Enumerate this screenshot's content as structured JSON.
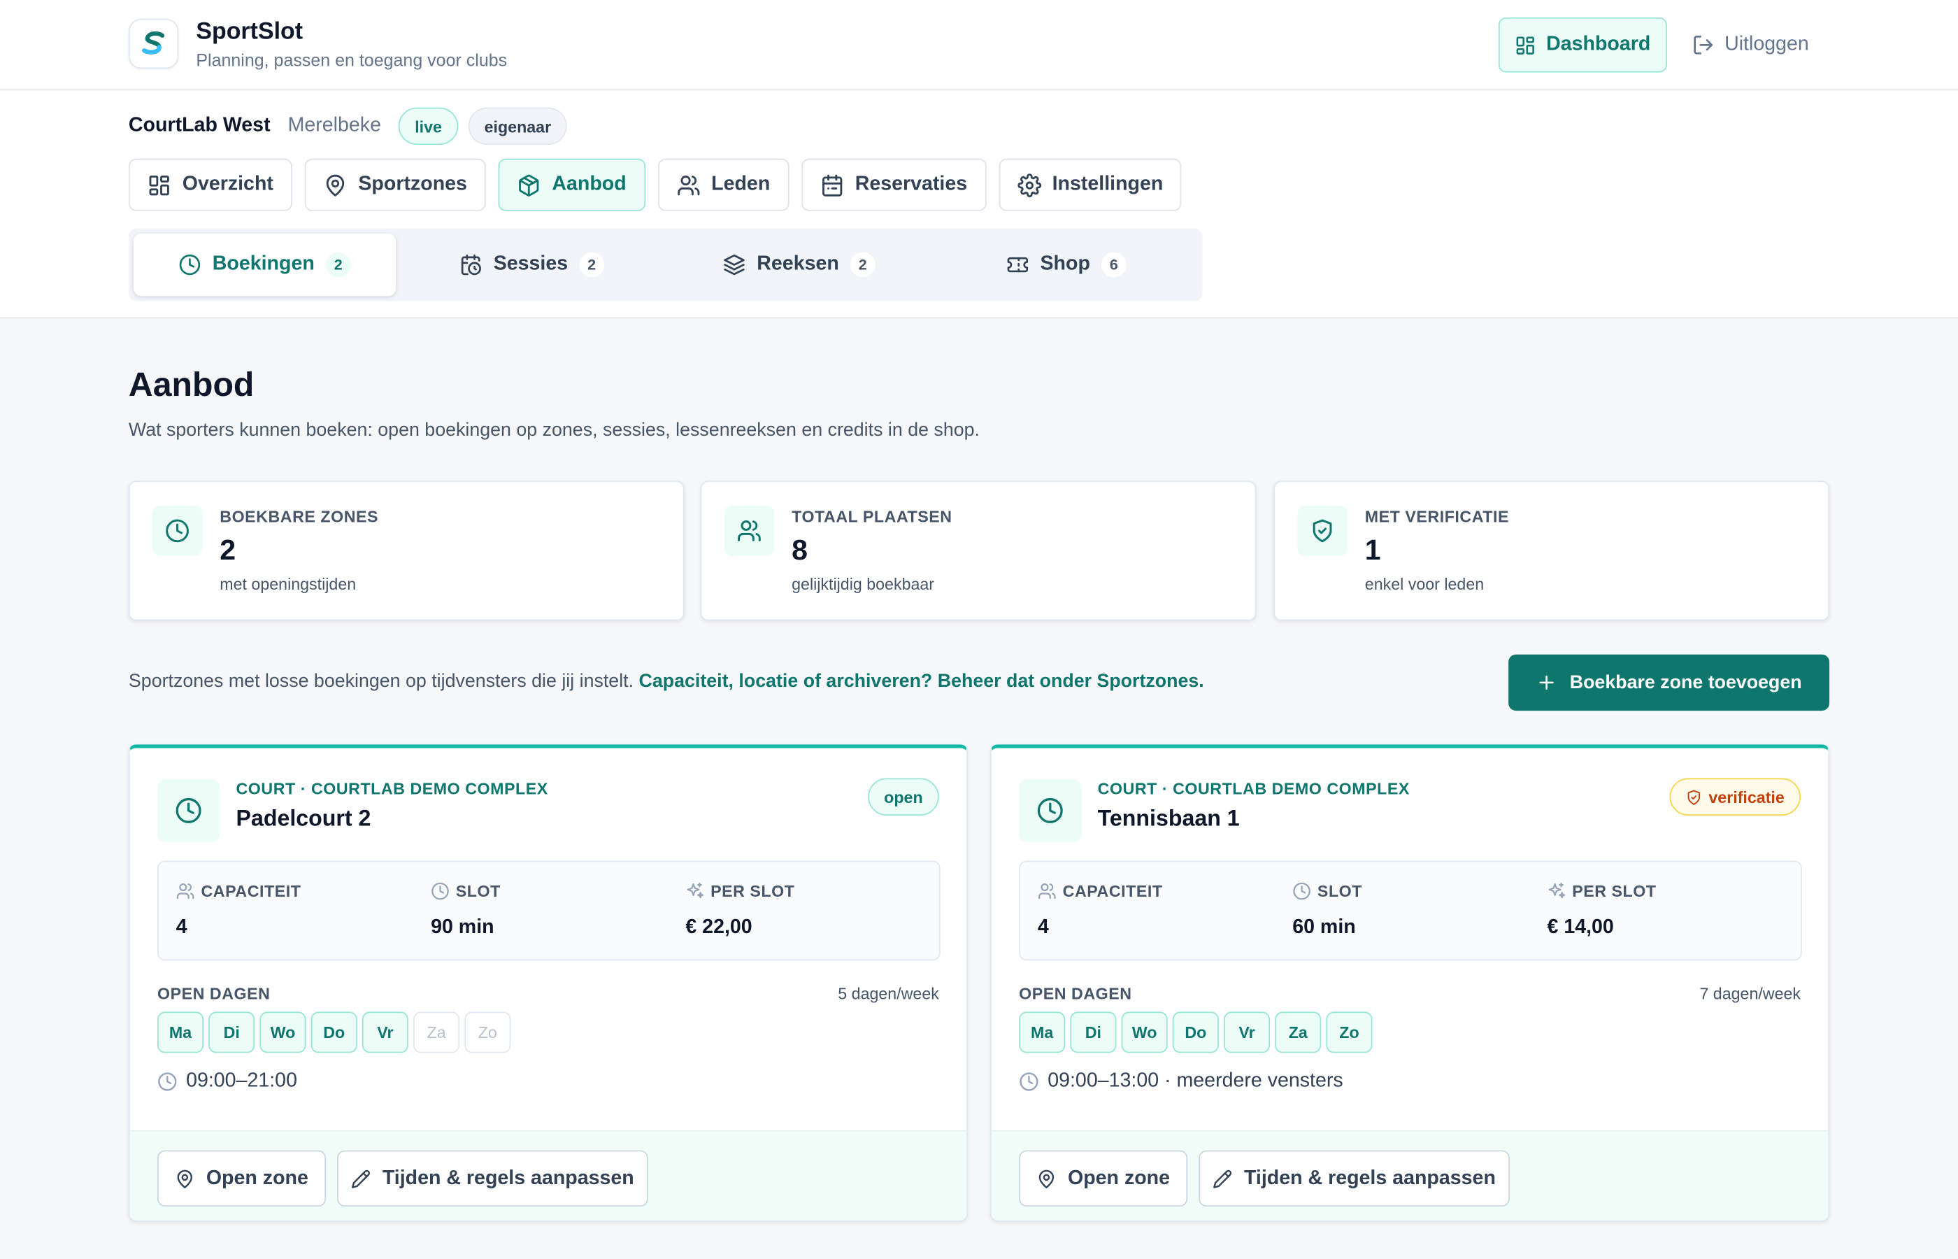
{
  "app": {
    "name": "SportSlot",
    "tagline": "Planning, passen en toegang voor clubs",
    "dashboard_label": "Dashboard",
    "logout_label": "Uitloggen"
  },
  "club": {
    "name": "CourtLab West",
    "city": "Merelbeke",
    "status": "live",
    "role": "eigenaar"
  },
  "tabs": [
    {
      "label": "Overzicht",
      "icon": "grid-icon"
    },
    {
      "label": "Sportzones",
      "icon": "map-pin-icon"
    },
    {
      "label": "Aanbod",
      "icon": "package-icon",
      "active": true
    },
    {
      "label": "Leden",
      "icon": "users-icon"
    },
    {
      "label": "Reservaties",
      "icon": "calendar-icon"
    },
    {
      "label": "Instellingen",
      "icon": "gear-icon"
    }
  ],
  "subtabs": [
    {
      "label": "Boekingen",
      "count": "2",
      "icon": "clock-icon",
      "active": true
    },
    {
      "label": "Sessies",
      "count": "2",
      "icon": "calendar-clock-icon"
    },
    {
      "label": "Reeksen",
      "count": "2",
      "icon": "layers-icon"
    },
    {
      "label": "Shop",
      "count": "6",
      "icon": "ticket-icon"
    }
  ],
  "page": {
    "title": "Aanbod",
    "description": "Wat sporters kunnen boeken: open boekingen op zones, sessies, lessenreeksen en credits in de shop."
  },
  "stats": [
    {
      "label": "BOEKBARE ZONES",
      "value": "2",
      "sub": "met openingstijden",
      "icon": "clock-icon"
    },
    {
      "label": "TOTAAL PLAATSEN",
      "value": "8",
      "sub": "gelijktijdig boekbaar",
      "icon": "users-icon"
    },
    {
      "label": "MET VERIFICATIE",
      "value": "1",
      "sub": "enkel voor leden",
      "icon": "shield-check-icon"
    }
  ],
  "intro": {
    "text": "Sportzones met losse boekingen op tijdvensters die jij instelt.",
    "link": "Capaciteit, locatie of archiveren? Beheer dat onder Sportzones."
  },
  "add_zone_label": "Boekbare zone toevoegen",
  "zones": [
    {
      "kicker": "COURT · COURTLAB DEMO COMPLEX",
      "name": "Padelcourt 2",
      "badge": "open",
      "capacity_label": "CAPACITEIT",
      "capacity": "4",
      "slot_label": "SLOT",
      "slot": "90 min",
      "price_label": "PER SLOT",
      "price": "€ 22,00",
      "open_days_label": "OPEN DAGEN",
      "days_per_week": "5 dagen/week",
      "days": [
        "Ma",
        "Di",
        "Wo",
        "Do",
        "Vr",
        "Za",
        "Zo"
      ],
      "days_open": [
        true,
        true,
        true,
        true,
        true,
        false,
        false
      ],
      "hours": "09:00–21:00",
      "open_zone_label": "Open zone",
      "edit_label": "Tijden & regels aanpassen"
    },
    {
      "kicker": "COURT · COURTLAB DEMO COMPLEX",
      "name": "Tennisbaan 1",
      "badge": "verificatie",
      "capacity_label": "CAPACITEIT",
      "capacity": "4",
      "slot_label": "SLOT",
      "slot": "60 min",
      "price_label": "PER SLOT",
      "price": "€ 14,00",
      "open_days_label": "OPEN DAGEN",
      "days_per_week": "7 dagen/week",
      "days": [
        "Ma",
        "Di",
        "Wo",
        "Do",
        "Vr",
        "Za",
        "Zo"
      ],
      "days_open": [
        true,
        true,
        true,
        true,
        true,
        true,
        true
      ],
      "hours": "09:00–13:00 · meerdere vensters",
      "open_zone_label": "Open zone",
      "edit_label": "Tijden & regels aanpassen"
    }
  ],
  "colors": {
    "accent": "#0f766e",
    "accent_light": "#ecfdf8",
    "card_top_border": "#14b8a6",
    "warning": "#c2410c"
  }
}
